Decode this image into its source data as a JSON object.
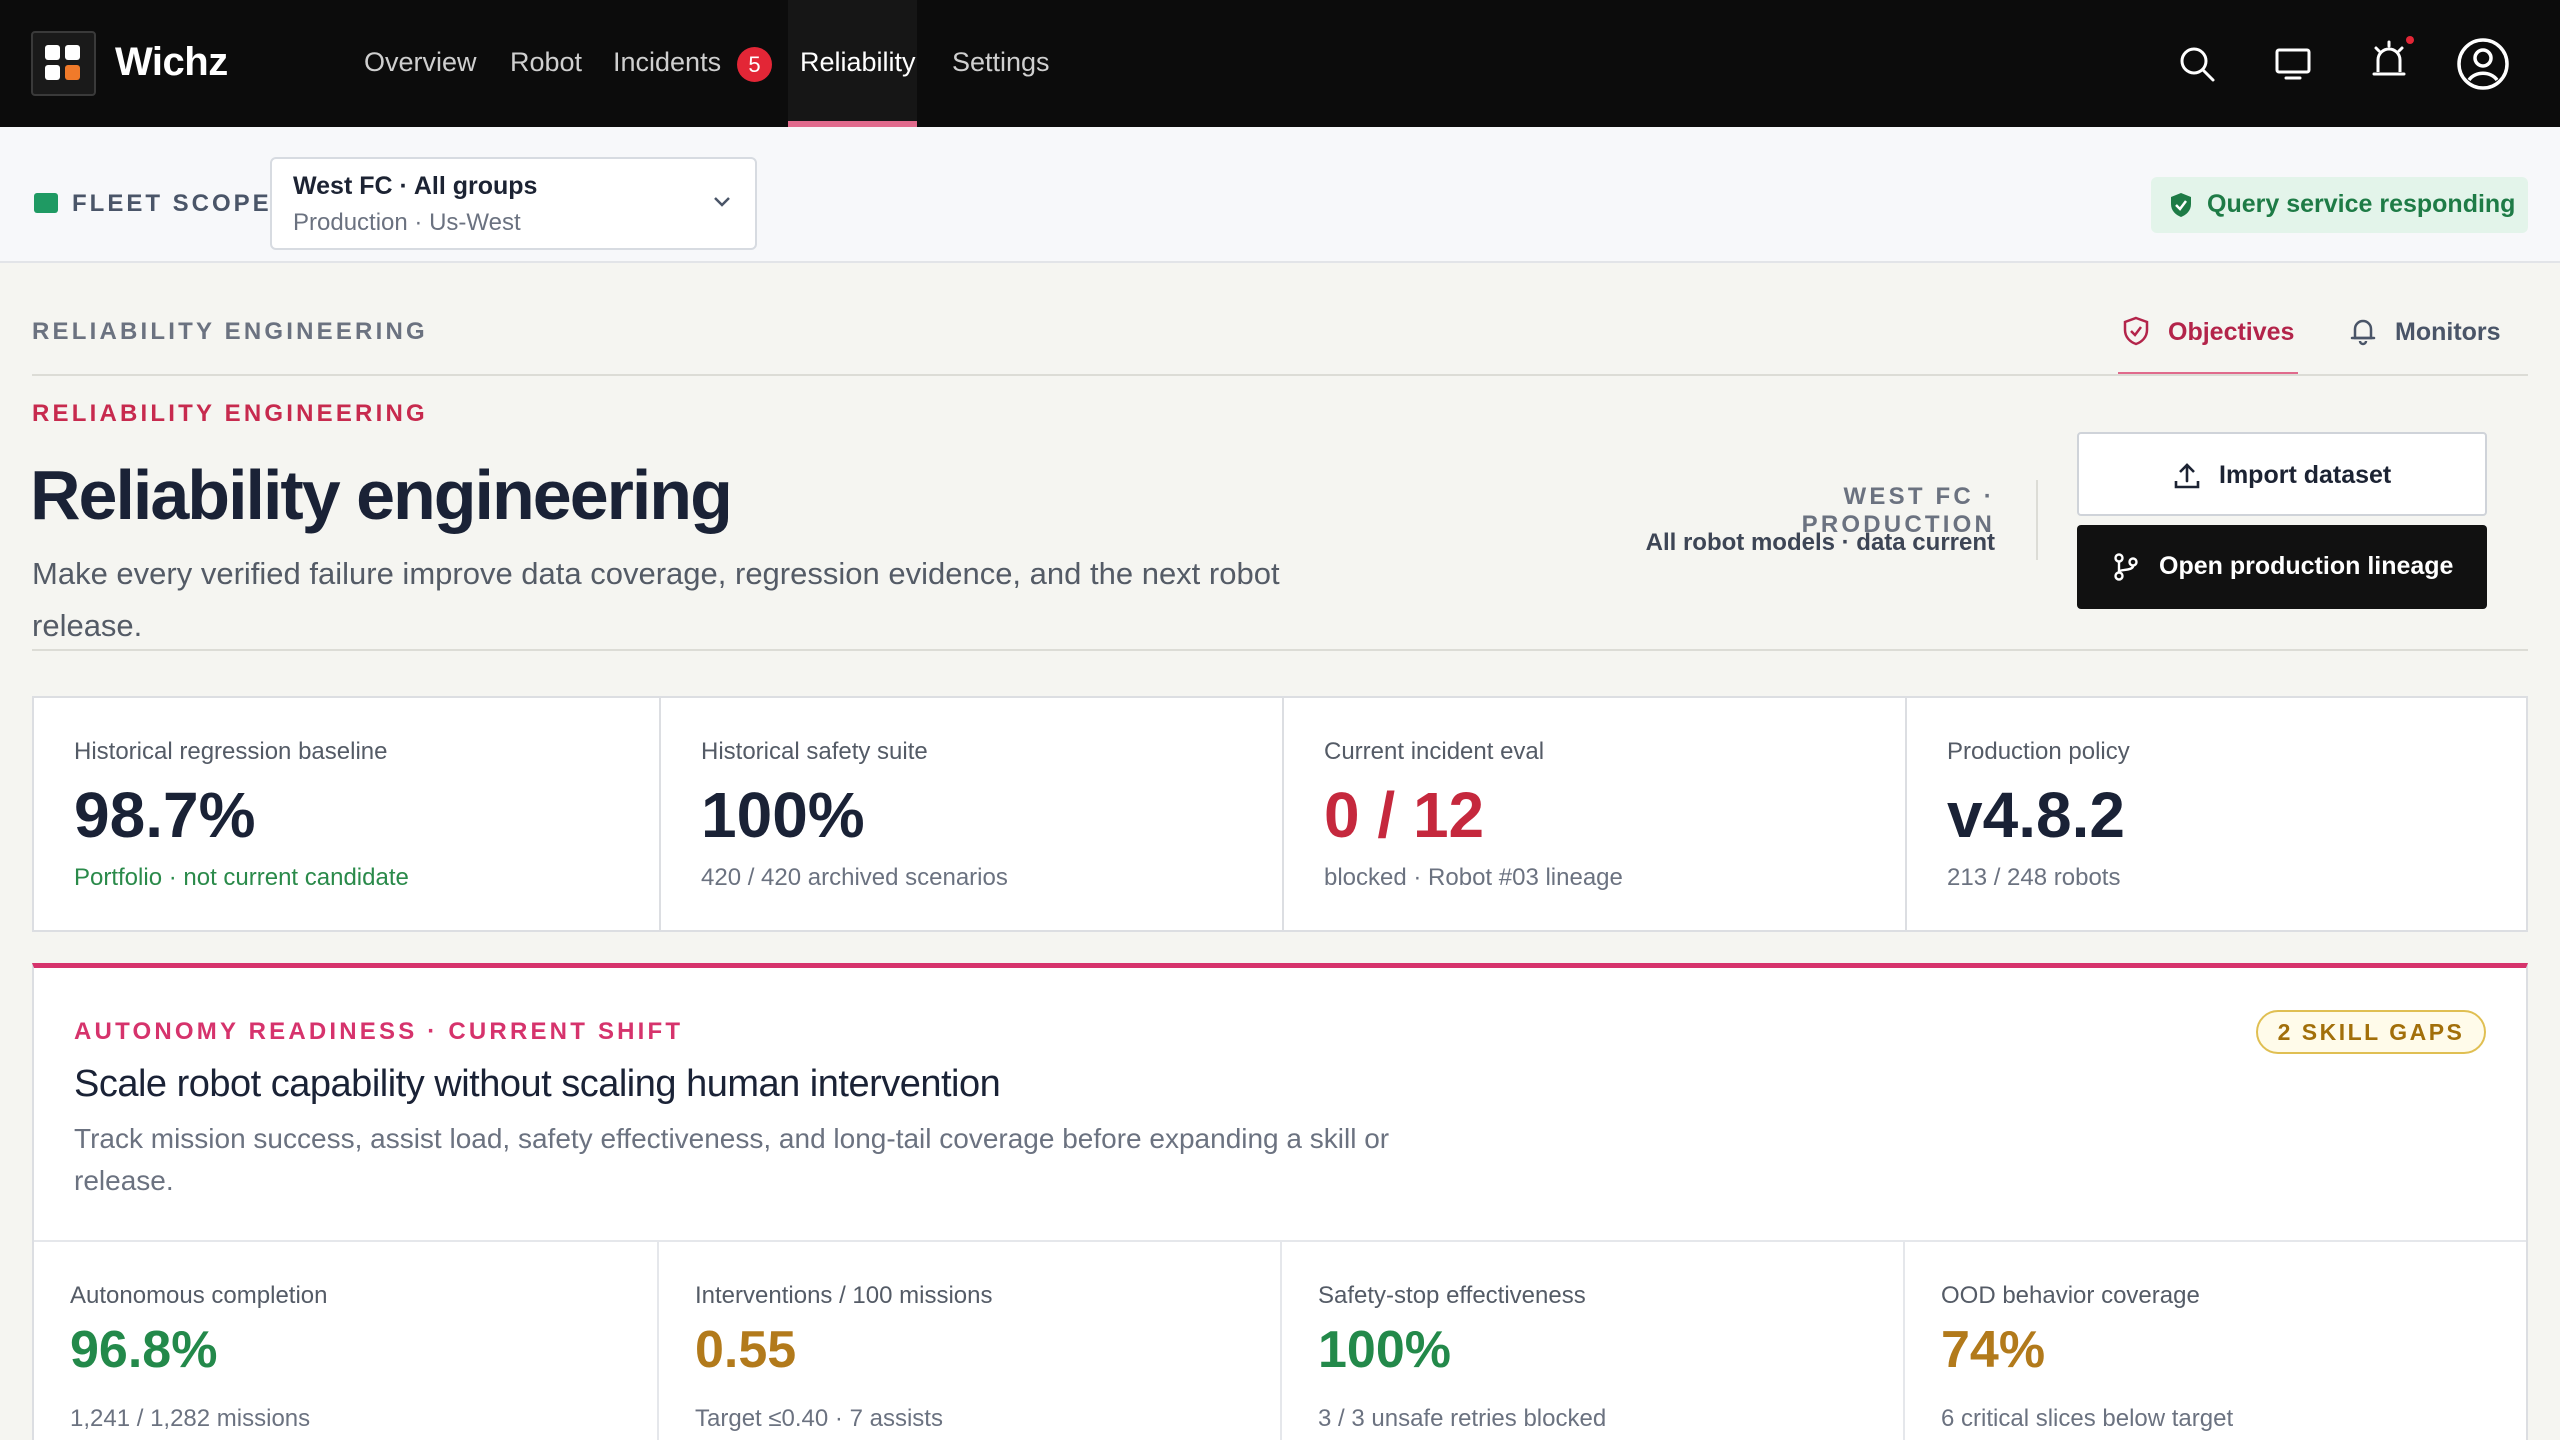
{
  "app": {
    "name": "Wichz"
  },
  "nav": {
    "items": [
      {
        "label": "Overview"
      },
      {
        "label": "Robot"
      },
      {
        "label": "Incidents",
        "badge": "5"
      },
      {
        "label": "Reliability",
        "active": true
      },
      {
        "label": "Settings"
      }
    ],
    "icons": [
      "search-icon",
      "monitor-icon",
      "alarm-icon",
      "account-icon"
    ]
  },
  "scope": {
    "label": "FLEET SCOPE",
    "selected_primary": "West FC · All groups",
    "selected_secondary": "Production · Us-West",
    "status": "Query service responding"
  },
  "section": {
    "eyebrow": "RELIABILITY ENGINEERING",
    "tabs": [
      {
        "label": "Objectives",
        "active": true,
        "icon": "shield-check-icon"
      },
      {
        "label": "Monitors",
        "active": false,
        "icon": "bell-icon"
      }
    ]
  },
  "header": {
    "eyebrow": "RELIABILITY ENGINEERING",
    "title": "Reliability engineering",
    "subtitle": "Make every verified failure improve data coverage, regression evidence, and the next robot release.",
    "context_primary": "WEST FC · PRODUCTION",
    "context_secondary": "All robot models · data current",
    "import_label": "Import dataset",
    "lineage_label": "Open production lineage"
  },
  "kpis": [
    {
      "label": "Historical regression baseline",
      "value": "98.7%",
      "sub": "Portfolio · not current candidate",
      "value_color": "#1a2236",
      "sub_color": "#2a8a4a"
    },
    {
      "label": "Historical safety suite",
      "value": "100%",
      "sub": "420 / 420 archived scenarios",
      "value_color": "#1a2236",
      "sub_color": "#6b7280"
    },
    {
      "label": "Current incident eval",
      "value": "0 / 12",
      "sub": "blocked · Robot #03 lineage",
      "value_color": "#c5283d",
      "sub_color": "#6b7280"
    },
    {
      "label": "Production policy",
      "value": "v4.8.2",
      "sub": "213 / 248 robots",
      "value_color": "#1a2236",
      "sub_color": "#6b7280"
    }
  ],
  "autonomy": {
    "eyebrow": "AUTONOMY READINESS · CURRENT SHIFT",
    "badge": "2 SKILL GAPS",
    "title": "Scale robot capability without scaling human intervention",
    "subtitle": "Track mission success, assist load, safety effectiveness, and long-tail coverage before expanding a skill or release.",
    "metrics": [
      {
        "label": "Autonomous completion",
        "value": "96.8%",
        "sub": "1,241 / 1,282 missions",
        "color": "#23894a"
      },
      {
        "label": "Interventions / 100 missions",
        "value": "0.55",
        "sub": "Target ≤0.40 · 7 assists",
        "color": "#b27a1b"
      },
      {
        "label": "Safety-stop effectiveness",
        "value": "100%",
        "sub": "3 / 3 unsafe retries blocked",
        "color": "#23894a"
      },
      {
        "label": "OOD behavior coverage",
        "value": "74%",
        "sub": "6 critical slices below target",
        "color": "#b27a1b"
      }
    ]
  },
  "colors": {
    "accent": "#e06a8c",
    "danger": "#c5283d",
    "success": "#23894a",
    "warning": "#b27a1b"
  }
}
